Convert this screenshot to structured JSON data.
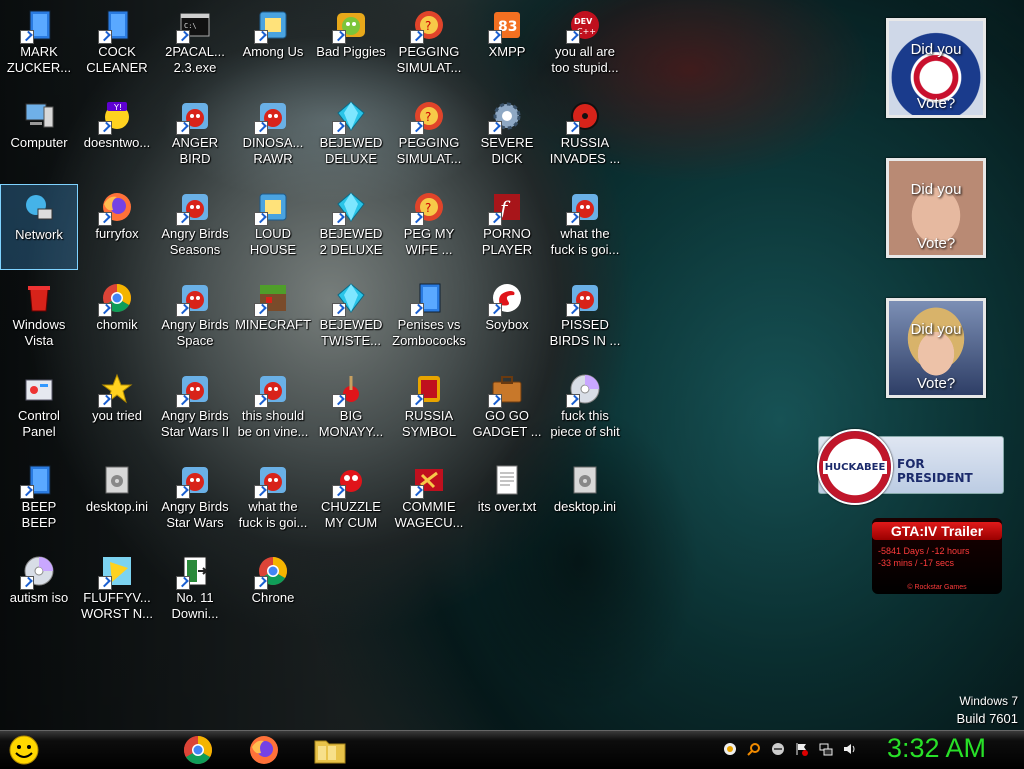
{
  "icons": [
    {
      "label": "MARK\nZUCKER...",
      "icon": "file-icon"
    },
    {
      "label": "COCK\nCLEANER",
      "icon": "file-icon"
    },
    {
      "label": "2PACAL...\n2.3.exe",
      "icon": "console-icon"
    },
    {
      "label": "Among Us",
      "icon": "app-icon"
    },
    {
      "label": "Bad Piggies",
      "icon": "pig-icon"
    },
    {
      "label": "PEGGING\nSIMULAT...",
      "icon": "circle-game-icon"
    },
    {
      "label": "XMPP",
      "icon": "xampp-icon"
    },
    {
      "label": "you all are\ntoo stupid...",
      "icon": "dev-cpp-icon"
    },
    {
      "label": "Computer",
      "icon": "computer-icon"
    },
    {
      "label": "doesntwo...",
      "icon": "yahoo-icon"
    },
    {
      "label": "ANGER\nBIRD",
      "icon": "angry-bird-icon"
    },
    {
      "label": "DINOSA...\nRAWR",
      "icon": "angry-bird-icon"
    },
    {
      "label": "BEJEWED\nDELUXE",
      "icon": "gem-icon"
    },
    {
      "label": "PEGGING\nSIMULAT...",
      "icon": "circle-game-icon"
    },
    {
      "label": "SEVERE\nDICK",
      "icon": "gear-icon"
    },
    {
      "label": "RUSSIA\nINVADES ...",
      "icon": "radiation-icon"
    },
    {
      "label": "Network",
      "icon": "network-icon"
    },
    {
      "label": "furryfox",
      "icon": "firefox-icon"
    },
    {
      "label": "Angry Birds\nSeasons",
      "icon": "angry-bird-icon"
    },
    {
      "label": "LOUD\nHOUSE",
      "icon": "app-icon"
    },
    {
      "label": "BEJEWED\n2 DELUXE",
      "icon": "gem-icon"
    },
    {
      "label": "PEG MY\nWIFE ...",
      "icon": "circle-game-icon"
    },
    {
      "label": "PORNO\nPLAYER",
      "icon": "flash-icon"
    },
    {
      "label": "what the\nfuck is goi...",
      "icon": "angry-bird-icon"
    },
    {
      "label": "Windows\nVista",
      "icon": "recycle-bin-icon"
    },
    {
      "label": "chomik",
      "icon": "chrome-icon"
    },
    {
      "label": "Angry Birds\nSpace",
      "icon": "angry-bird-icon"
    },
    {
      "label": "MINECRAFT",
      "icon": "minecraft-icon"
    },
    {
      "label": "BEJEWED\nTWISTE...",
      "icon": "gem-icon"
    },
    {
      "label": "Penises vs\nZombococks",
      "icon": "file-icon"
    },
    {
      "label": "Soybox",
      "icon": "soybox-icon"
    },
    {
      "label": "PISSED\nBIRDS IN ...",
      "icon": "angry-bird-icon"
    },
    {
      "label": "Control\nPanel",
      "icon": "control-panel-icon"
    },
    {
      "label": "you tried",
      "icon": "star-icon"
    },
    {
      "label": "Angry Birds\nStar Wars II",
      "icon": "angry-bird-icon"
    },
    {
      "label": "this should\nbe on vine...",
      "icon": "angry-bird-icon"
    },
    {
      "label": "BIG\nMONAYY...",
      "icon": "money-icon"
    },
    {
      "label": "RUSSIA\nSYMBOL",
      "icon": "russia-icon"
    },
    {
      "label": "GO GO\nGADGET ...",
      "icon": "briefcase-icon"
    },
    {
      "label": "fuck this\npiece of shit",
      "icon": "disc-icon"
    },
    {
      "label": "BEEP\nBEEP",
      "icon": "file-icon"
    },
    {
      "label": "desktop.ini",
      "icon": "settings-file-icon"
    },
    {
      "label": "Angry Birds\nStar Wars",
      "icon": "angry-bird-icon"
    },
    {
      "label": "what the\nfuck is goi...",
      "icon": "angry-bird-icon"
    },
    {
      "label": "CHUZZLE\nMY CUM",
      "icon": "chuzzle-icon"
    },
    {
      "label": "COMMIE\nWAGECU...",
      "icon": "commie-icon"
    },
    {
      "label": "its over.txt",
      "icon": "text-file-icon"
    },
    {
      "label": "desktop.ini",
      "icon": "settings-file-icon"
    },
    {
      "label": "autism iso",
      "icon": "disc-icon"
    },
    {
      "label": "FLUFFYV...\nWORST N...",
      "icon": "fluffy-icon"
    },
    {
      "label": "No. 11\nDowni...",
      "icon": "exit-door-icon"
    },
    {
      "label": "Chrone",
      "icon": "chrome-icon"
    }
  ],
  "gadgets": {
    "vote_top": "Did you",
    "vote_bottom": "Vote?",
    "huckabee_seal": "HUCKABEE",
    "huckabee_text": "FOR PRESIDENT",
    "gta_title": "GTA:IV  Trailer",
    "gta_line1": "-5841 Days / -12 hours",
    "gta_line2": "-33 mins / -17 secs",
    "gta_footer": "© Rockstar Games"
  },
  "watermark": {
    "line1": "Windows 7",
    "line2": "Build 7601"
  },
  "taskbar": {
    "clock": "3:32 AM"
  },
  "colors": {
    "clock": "#28e028",
    "label_text": "#ffffff",
    "taskbar": "#000000"
  }
}
